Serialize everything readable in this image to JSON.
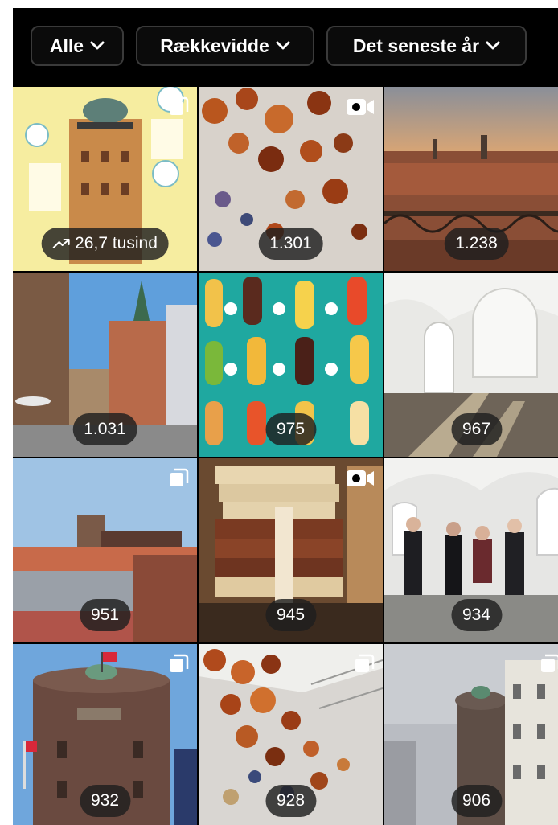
{
  "filters": [
    {
      "label": "Alle"
    },
    {
      "label": "Rækkevidde"
    },
    {
      "label": "Det seneste år"
    }
  ],
  "tiles": [
    {
      "count": "26,7 tusind",
      "trending": true,
      "corner": "multi"
    },
    {
      "count": "1.301",
      "corner": "video"
    },
    {
      "count": "1.238",
      "corner": "none"
    },
    {
      "count": "1.031",
      "corner": "none"
    },
    {
      "count": "975",
      "corner": "none"
    },
    {
      "count": "967",
      "corner": "none"
    },
    {
      "count": "951",
      "corner": "multi"
    },
    {
      "count": "945",
      "corner": "video"
    },
    {
      "count": "934",
      "corner": "none"
    },
    {
      "count": "932",
      "corner": "multi"
    },
    {
      "count": "928",
      "corner": "multi"
    },
    {
      "count": "906",
      "corner": "multi"
    }
  ],
  "icons": {
    "chevron": "chevron-down-icon",
    "trending": "trending-up-icon",
    "video": "video-icon",
    "multi": "carousel-icon"
  }
}
